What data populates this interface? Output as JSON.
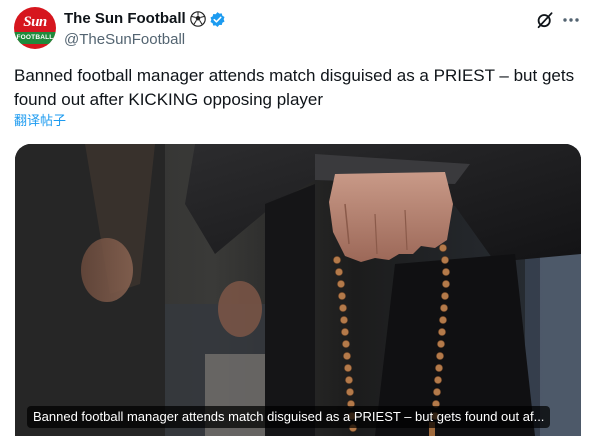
{
  "post": {
    "author": {
      "display_name": "The Sun Football",
      "handle": "@TheSunFootball",
      "avatar_logo_text": "Sun",
      "avatar_band_text": "FOOTBALL",
      "verified": true
    },
    "text": "Banned football manager attends match disguised as a PRIEST – but gets found out after KICKING opposing player",
    "translate_label": "翻译帖子",
    "media": {
      "card_caption": "Banned football manager attends match disguised as a PRIEST – but gets found out af..."
    }
  },
  "icons": {
    "ball": "soccer-ball-icon",
    "verified": "verified-badge-icon",
    "grok": "grok-icon",
    "more": "more-options-icon"
  },
  "colors": {
    "link": "#1d9bf0",
    "verified": "#1d9bf0",
    "secondary_text": "#536471",
    "primary_text": "#0f1419",
    "brand_red": "#d6161e"
  }
}
